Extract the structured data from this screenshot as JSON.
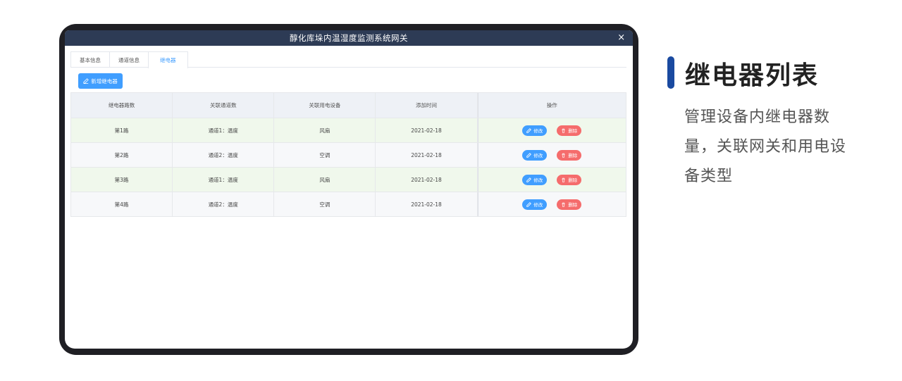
{
  "window": {
    "title": "醇化库垛内温湿度监测系统网关",
    "close_icon": "×"
  },
  "tabs": [
    {
      "label": "基本信息",
      "active": false
    },
    {
      "label": "通道信息",
      "active": false
    },
    {
      "label": "继电器",
      "active": true
    }
  ],
  "toolbar": {
    "add_label": "新增继电器"
  },
  "table": {
    "headers": [
      "继电器路数",
      "关联通道数",
      "关联用电设备",
      "添加时间",
      "操作"
    ],
    "rows": [
      {
        "route": "第1路",
        "channel": "通道1：温度",
        "device": "风扇",
        "time": "2021-02-18",
        "edit": "修改",
        "delete": "删除"
      },
      {
        "route": "第2路",
        "channel": "通道2：温度",
        "device": "空调",
        "time": "2021-02-18",
        "edit": "修改",
        "delete": "删除"
      },
      {
        "route": "第3路",
        "channel": "通道1：温度",
        "device": "风扇",
        "time": "2021-02-18",
        "edit": "修改",
        "delete": "删除"
      },
      {
        "route": "第4路",
        "channel": "通道2：温度",
        "device": "空调",
        "time": "2021-02-18",
        "edit": "修改",
        "delete": "删除"
      }
    ]
  },
  "side": {
    "heading": "继电器列表",
    "description": "管理设备内继电器数量，关联网关和用电设备类型"
  },
  "colors": {
    "primary": "#409eff",
    "danger": "#f56c6c",
    "titlebar": "#2d3b55",
    "accent": "#1a4aa0",
    "row_green": "#f0f8ec"
  }
}
